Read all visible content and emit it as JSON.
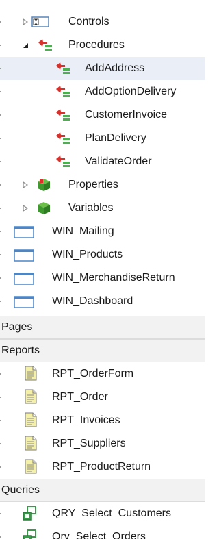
{
  "tree": {
    "controls": {
      "label": "Controls",
      "icon": "control-icon",
      "expander": "collapsed"
    },
    "procedures": {
      "label": "Procedures",
      "icon": "procedures-icon",
      "expander": "expanded",
      "items": [
        {
          "label": "AddAddress",
          "icon": "procedure-icon",
          "selected": true
        },
        {
          "label": "AddOptionDelivery",
          "icon": "procedure-icon"
        },
        {
          "label": "CustomerInvoice",
          "icon": "procedure-icon"
        },
        {
          "label": "PlanDelivery",
          "icon": "procedure-icon"
        },
        {
          "label": "ValidateOrder",
          "icon": "procedure-icon"
        }
      ]
    },
    "properties": {
      "label": "Properties",
      "icon": "properties-icon",
      "expander": "collapsed"
    },
    "variables": {
      "label": "Variables",
      "icon": "variables-icon",
      "expander": "collapsed"
    },
    "windows": [
      {
        "label": "WIN_Mailing",
        "icon": "window-icon"
      },
      {
        "label": "WIN_Products",
        "icon": "window-icon"
      },
      {
        "label": "WIN_MerchandiseReturn",
        "icon": "window-icon"
      },
      {
        "label": "WIN_Dashboard",
        "icon": "window-icon"
      }
    ],
    "sections": {
      "pages": "Pages",
      "reports": "Reports",
      "queries": "Queries"
    },
    "reports": [
      {
        "label": "RPT_OrderForm",
        "icon": "report-icon"
      },
      {
        "label": "RPT_Order",
        "icon": "report-icon"
      },
      {
        "label": "RPT_Invoices",
        "icon": "report-icon"
      },
      {
        "label": "RPT_Suppliers",
        "icon": "report-icon"
      },
      {
        "label": "RPT_ProductReturn",
        "icon": "report-icon"
      }
    ],
    "queries": [
      {
        "label": "QRY_Select_Customers",
        "icon": "query-icon"
      },
      {
        "label": "Qry_Select_Orders",
        "icon": "query-icon"
      }
    ]
  },
  "colors": {
    "selection": "#e9eef7",
    "section_background": "#f2f2f2",
    "procedure_red": "#d8302a",
    "procedure_green": "#4caf50",
    "report_page": "#f4f0a8",
    "window_border": "#4a86c8",
    "query_green": "#3a9a4a"
  }
}
